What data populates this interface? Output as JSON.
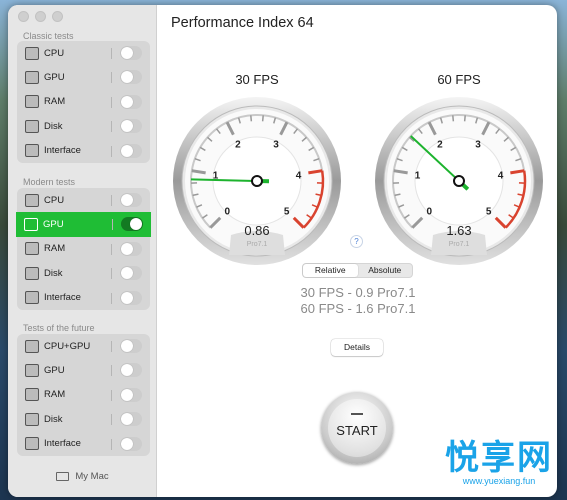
{
  "sidebar": {
    "sections": [
      {
        "label": "Classic tests",
        "items": [
          {
            "label": "CPU",
            "icon": "cpu-icon",
            "on": false
          },
          {
            "label": "GPU",
            "icon": "gpu-icon",
            "on": false
          },
          {
            "label": "RAM",
            "icon": "ram-icon",
            "on": false
          },
          {
            "label": "Disk",
            "icon": "ssd-icon",
            "on": false
          },
          {
            "label": "Interface",
            "icon": "usb-icon",
            "on": false
          }
        ]
      },
      {
        "label": "Modern tests",
        "items": [
          {
            "label": "CPU",
            "icon": "cpu-icon",
            "on": false
          },
          {
            "label": "GPU",
            "icon": "gpu-icon",
            "on": true
          },
          {
            "label": "RAM",
            "icon": "ram-icon",
            "on": false
          },
          {
            "label": "Disk",
            "icon": "ssd-icon",
            "on": false
          },
          {
            "label": "Interface",
            "icon": "usb-icon",
            "on": false
          }
        ]
      },
      {
        "label": "Tests of the future",
        "items": [
          {
            "label": "CPU+GPU",
            "icon": "cpu-gpu-icon",
            "on": false
          },
          {
            "label": "GPU",
            "icon": "gpu-icon",
            "on": false
          },
          {
            "label": "RAM",
            "icon": "ram-icon",
            "on": false
          },
          {
            "label": "Disk",
            "icon": "ssd-icon",
            "on": false
          },
          {
            "label": "Interface",
            "icon": "usb-icon",
            "on": false
          }
        ]
      }
    ],
    "my_mac": "My Mac"
  },
  "main": {
    "title": "Performance Index 64",
    "gauges": [
      {
        "label": "30 FPS",
        "value": 0.86,
        "value_text": "0.86",
        "unit": "Pro7.1"
      },
      {
        "label": "60 FPS",
        "value": 1.63,
        "value_text": "1.63",
        "unit": "Pro7.1"
      }
    ],
    "gauge_scale": {
      "min": 0,
      "max": 5,
      "ticks": [
        "0",
        "1",
        "2",
        "3",
        "4",
        "5"
      ],
      "red_from": 4
    },
    "help": "?",
    "segmented": {
      "options": [
        "Relative",
        "Absolute"
      ],
      "selected": "Relative"
    },
    "results": [
      "30 FPS - 0.9 Pro7.1",
      "60 FPS - 1.6 Pro7.1"
    ],
    "details": "Details",
    "start": "START"
  },
  "colors": {
    "accent": "#1fbd35",
    "needle": "#1db32e",
    "red_zone": "#d9432f"
  },
  "watermark": {
    "big": "悦享网",
    "small": "www.yuexiang.fun"
  }
}
